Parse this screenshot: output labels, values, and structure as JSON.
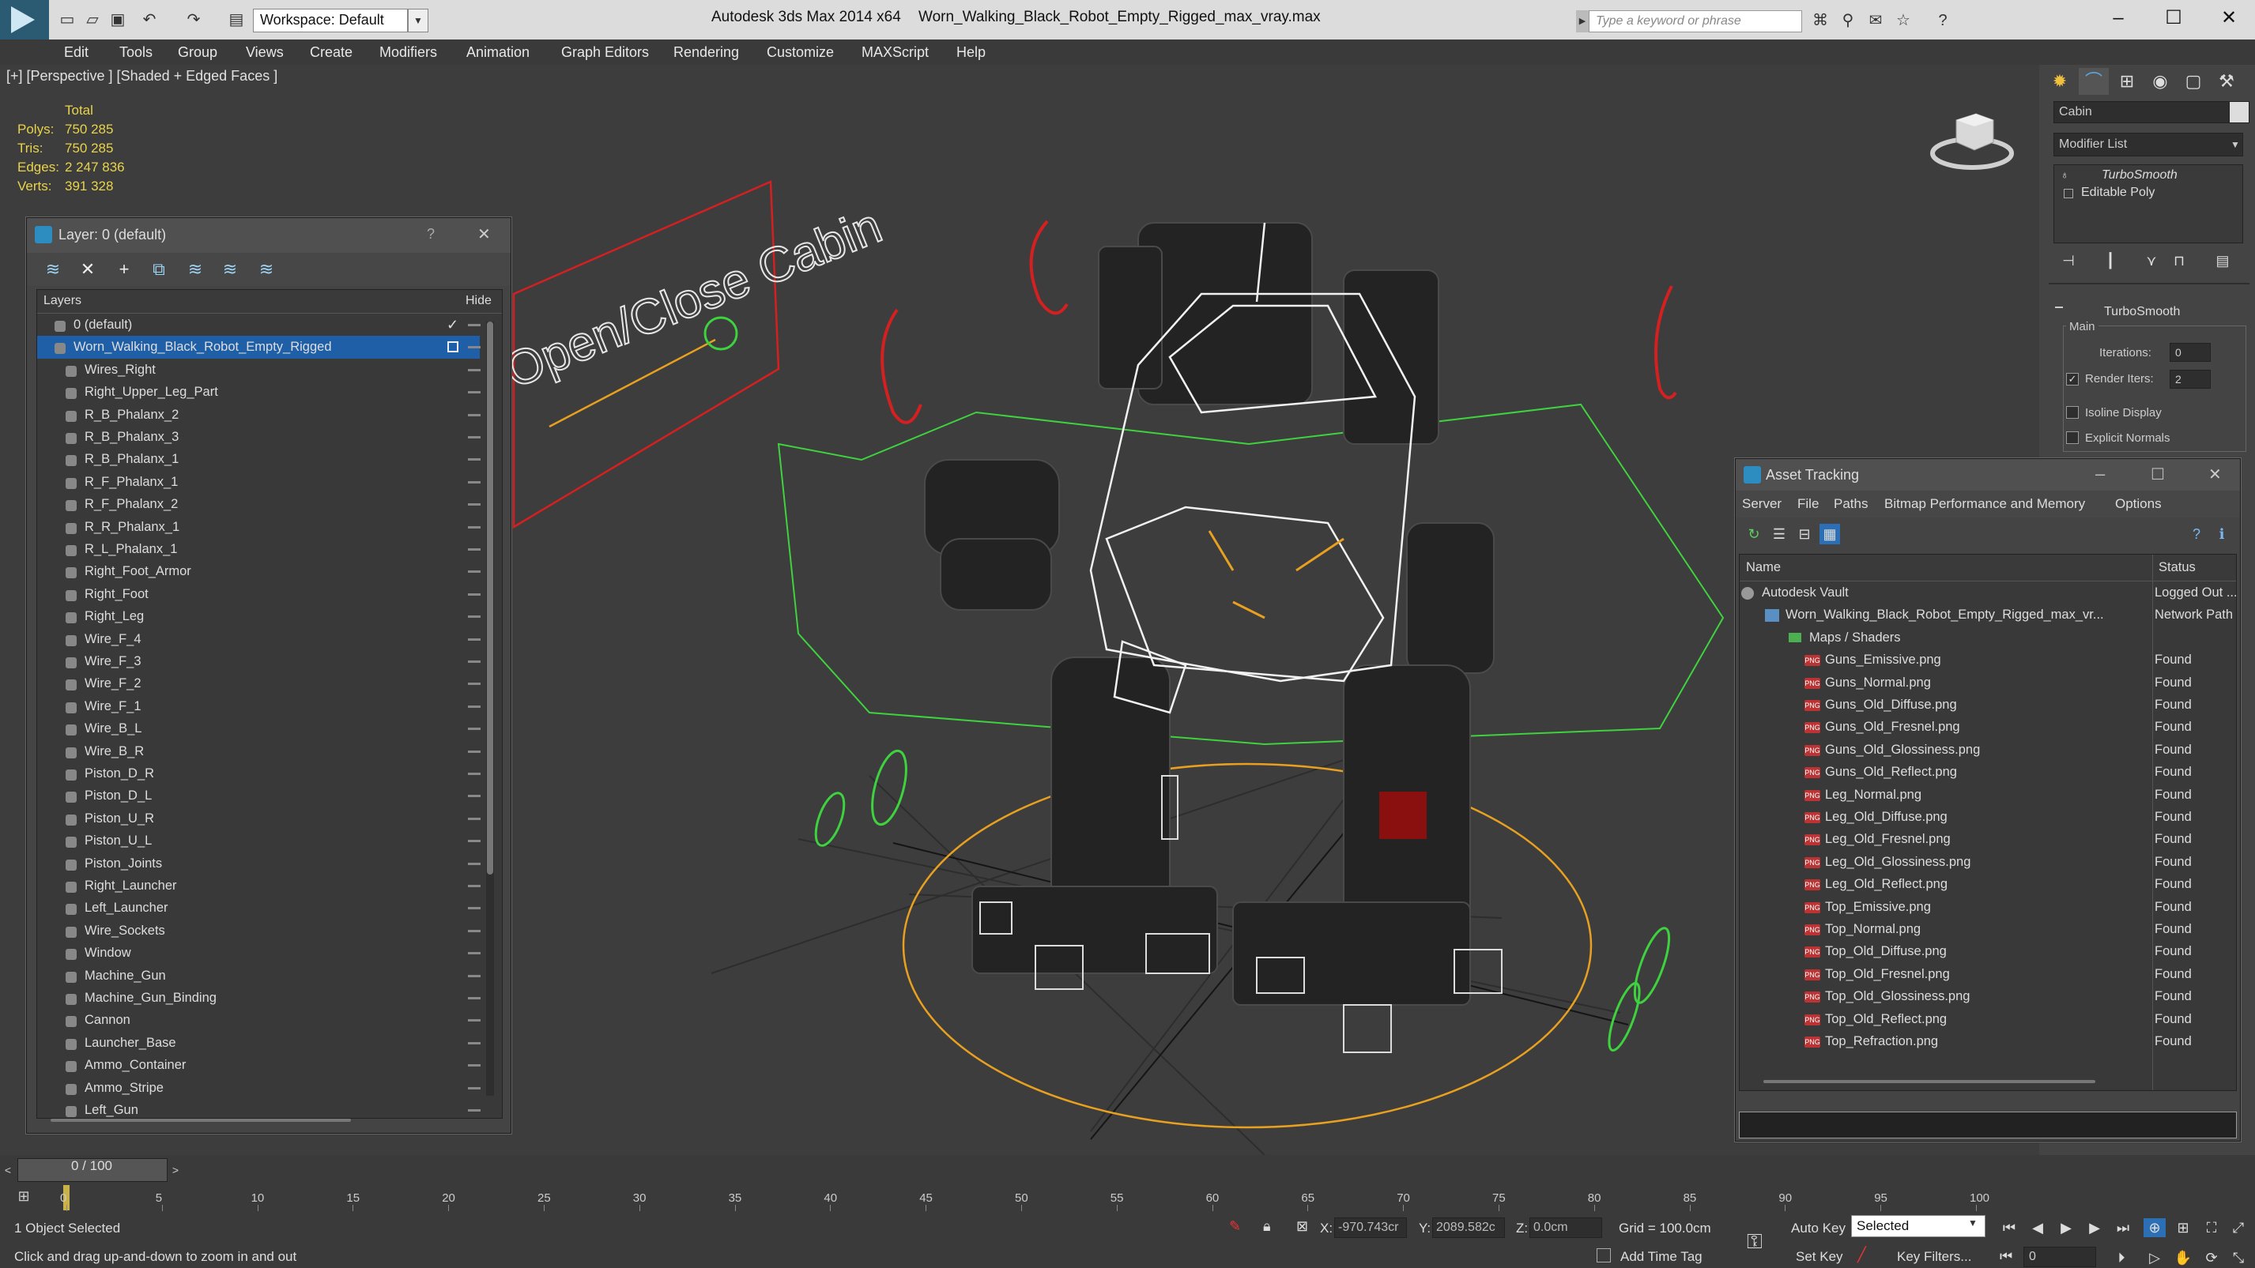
{
  "titlebar": {
    "workspace_label": "Workspace: Default",
    "app_title": "Autodesk 3ds Max  2014 x64",
    "file_title": "Worn_Walking_Black_Robot_Empty_Rigged_max_vray.max",
    "search_placeholder": "Type a keyword or phrase"
  },
  "menu": [
    "Edit",
    "Tools",
    "Group",
    "Views",
    "Create",
    "Modifiers",
    "Animation",
    "Graph Editors",
    "Rendering",
    "Customize",
    "MAXScript",
    "Help"
  ],
  "viewport": {
    "label": "[+] [Perspective ] [Shaded + Edged Faces ]",
    "stats": {
      "total_label": "Total",
      "polys_label": "Polys:",
      "polys": "750 285",
      "tris_label": "Tris:",
      "tris": "750 285",
      "edges_label": "Edges:",
      "edges": "2 247 836",
      "verts_label": "Verts:",
      "verts": "391 328"
    },
    "sign_text": "Open/Close Cabin"
  },
  "layer_dialog": {
    "title": "Layer: 0 (default)",
    "help": "?",
    "close": "✕",
    "col_layers": "Layers",
    "col_hide": "Hide",
    "rows": [
      {
        "label": "0 (default)",
        "level": 0,
        "selected": false
      },
      {
        "label": "Worn_Walking_Black_Robot_Empty_Rigged",
        "level": 0,
        "selected": true
      },
      {
        "label": "Wires_Right",
        "level": 1
      },
      {
        "label": "Right_Upper_Leg_Part",
        "level": 1
      },
      {
        "label": "R_B_Phalanx_2",
        "level": 1
      },
      {
        "label": "R_B_Phalanx_3",
        "level": 1
      },
      {
        "label": "R_B_Phalanx_1",
        "level": 1
      },
      {
        "label": "R_F_Phalanx_1",
        "level": 1
      },
      {
        "label": "R_F_Phalanx_2",
        "level": 1
      },
      {
        "label": "R_R_Phalanx_1",
        "level": 1
      },
      {
        "label": "R_L_Phalanx_1",
        "level": 1
      },
      {
        "label": "Right_Foot_Armor",
        "level": 1
      },
      {
        "label": "Right_Foot",
        "level": 1
      },
      {
        "label": "Right_Leg",
        "level": 1
      },
      {
        "label": "Wire_F_4",
        "level": 1
      },
      {
        "label": "Wire_F_3",
        "level": 1
      },
      {
        "label": "Wire_F_2",
        "level": 1
      },
      {
        "label": "Wire_F_1",
        "level": 1
      },
      {
        "label": "Wire_B_L",
        "level": 1
      },
      {
        "label": "Wire_B_R",
        "level": 1
      },
      {
        "label": "Piston_D_R",
        "level": 1
      },
      {
        "label": "Piston_D_L",
        "level": 1
      },
      {
        "label": "Piston_U_R",
        "level": 1
      },
      {
        "label": "Piston_U_L",
        "level": 1
      },
      {
        "label": "Piston_Joints",
        "level": 1
      },
      {
        "label": "Right_Launcher",
        "level": 1
      },
      {
        "label": "Left_Launcher",
        "level": 1
      },
      {
        "label": "Wire_Sockets",
        "level": 1
      },
      {
        "label": "Window",
        "level": 1
      },
      {
        "label": "Machine_Gun",
        "level": 1
      },
      {
        "label": "Machine_Gun_Binding",
        "level": 1
      },
      {
        "label": "Cannon",
        "level": 1
      },
      {
        "label": "Launcher_Base",
        "level": 1
      },
      {
        "label": "Ammo_Container",
        "level": 1
      },
      {
        "label": "Ammo_Stripe",
        "level": 1
      },
      {
        "label": "Left_Gun",
        "level": 1
      }
    ]
  },
  "command_panel": {
    "object_name": "Cabin",
    "modifier_list": "Modifier List",
    "stack": [
      "TurboSmooth",
      "Editable Poly"
    ],
    "rollout_title": "TurboSmooth",
    "main_label": "Main",
    "iterations_label": "Iterations:",
    "iterations_value": "0",
    "render_iters_label": "Render Iters:",
    "render_iters_value": "2",
    "isoline_label": "Isoline Display",
    "explicit_label": "Explicit Normals"
  },
  "asset_tracking": {
    "title": "Asset Tracking",
    "menu": [
      "Server",
      "File",
      "Paths",
      "Bitmap Performance and Memory",
      "Options"
    ],
    "col_name": "Name",
    "col_status": "Status",
    "rows": [
      {
        "name": "Autodesk Vault",
        "status": "Logged Out ...",
        "level": 0,
        "type": "vault"
      },
      {
        "name": "Worn_Walking_Black_Robot_Empty_Rigged_max_vr...",
        "status": "Network Path",
        "level": 1,
        "type": "file"
      },
      {
        "name": "Maps / Shaders",
        "status": "",
        "level": 2,
        "type": "folder"
      },
      {
        "name": "Guns_Emissive.png",
        "status": "Found",
        "level": 3,
        "type": "png"
      },
      {
        "name": "Guns_Normal.png",
        "status": "Found",
        "level": 3,
        "type": "png"
      },
      {
        "name": "Guns_Old_Diffuse.png",
        "status": "Found",
        "level": 3,
        "type": "png"
      },
      {
        "name": "Guns_Old_Fresnel.png",
        "status": "Found",
        "level": 3,
        "type": "png"
      },
      {
        "name": "Guns_Old_Glossiness.png",
        "status": "Found",
        "level": 3,
        "type": "png"
      },
      {
        "name": "Guns_Old_Reflect.png",
        "status": "Found",
        "level": 3,
        "type": "png"
      },
      {
        "name": "Leg_Normal.png",
        "status": "Found",
        "level": 3,
        "type": "png"
      },
      {
        "name": "Leg_Old_Diffuse.png",
        "status": "Found",
        "level": 3,
        "type": "png"
      },
      {
        "name": "Leg_Old_Fresnel.png",
        "status": "Found",
        "level": 3,
        "type": "png"
      },
      {
        "name": "Leg_Old_Glossiness.png",
        "status": "Found",
        "level": 3,
        "type": "png"
      },
      {
        "name": "Leg_Old_Reflect.png",
        "status": "Found",
        "level": 3,
        "type": "png"
      },
      {
        "name": "Top_Emissive.png",
        "status": "Found",
        "level": 3,
        "type": "png"
      },
      {
        "name": "Top_Normal.png",
        "status": "Found",
        "level": 3,
        "type": "png"
      },
      {
        "name": "Top_Old_Diffuse.png",
        "status": "Found",
        "level": 3,
        "type": "png"
      },
      {
        "name": "Top_Old_Fresnel.png",
        "status": "Found",
        "level": 3,
        "type": "png"
      },
      {
        "name": "Top_Old_Glossiness.png",
        "status": "Found",
        "level": 3,
        "type": "png"
      },
      {
        "name": "Top_Old_Reflect.png",
        "status": "Found",
        "level": 3,
        "type": "png"
      },
      {
        "name": "Top_Refraction.png",
        "status": "Found",
        "level": 3,
        "type": "png"
      }
    ]
  },
  "timeline": {
    "slider_label": "0 / 100",
    "ticks": [
      "0",
      "5",
      "10",
      "15",
      "20",
      "25",
      "30",
      "35",
      "40",
      "45",
      "50",
      "55",
      "60",
      "65",
      "70",
      "75",
      "80",
      "85",
      "90",
      "95",
      "100"
    ]
  },
  "status": {
    "selection": "1 Object Selected",
    "prompt": "Click and drag up-and-down to zoom in and out",
    "x_label": "X:",
    "x_value": "-970.743cr",
    "y_label": "Y:",
    "y_value": "2089.582c",
    "z_label": "Z:",
    "z_value": "0.0cm",
    "grid": "Grid = 100.0cm",
    "auto_key": "Auto Key",
    "set_key": "Set Key",
    "selected_dd": "Selected",
    "key_filters": "Key Filters...",
    "add_time_tag": "Add Time Tag",
    "frame": "0"
  },
  "colors": {
    "accent": "#1e5fa8",
    "stats_yellow": "#e8d34a",
    "wire_green": "#3fd23f",
    "wire_red": "#d42020",
    "ground_orange": "#e8a020"
  }
}
